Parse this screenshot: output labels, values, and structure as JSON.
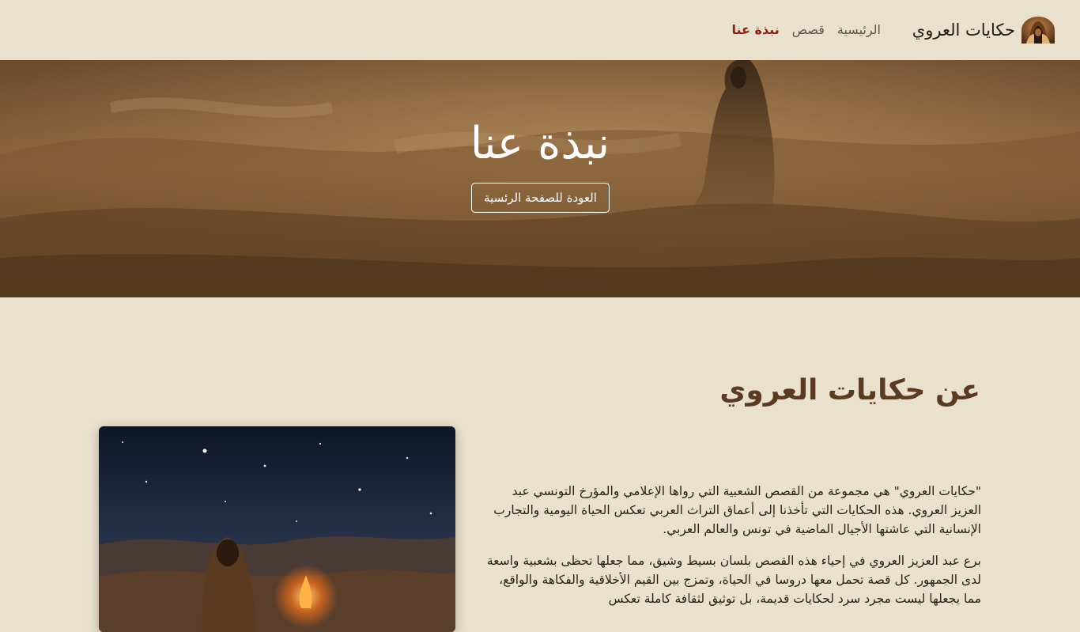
{
  "navbar": {
    "brand_name": "حكايات العروي",
    "links": [
      {
        "label": "الرئيسية"
      },
      {
        "label": "قصص"
      },
      {
        "label": "نبذة عنا"
      }
    ]
  },
  "hero": {
    "title": "نبذة عنا",
    "button_label": "العودة للصفحة الرئسية"
  },
  "about": {
    "title": "عن حكايات العروي",
    "paragraphs": [
      "\"حكايات العروي\" هي مجموعة من القصص الشعبية التي رواها الإعلامي والمؤرخ التونسي عبد العزيز العروي. هذه الحكايات التي تأخذنا إلى أعماق التراث العربي تعكس الحياة اليومية والتجارب الإنسانية التي عاشتها الأجيال الماضية في تونس والعالم العربي.",
      "برع عبد العزيز العروي في إحياء هذه القصص بلسان بسيط وشيق، مما جعلها تحظى بشعبية واسعة لدى الجمهور. كل قصة تحمل معها دروسا في الحياة، وتمزج بين القيم الأخلاقية والفكاهة والواقع، مما يجعلها ليست مجرد سرد لحكايات قديمة، بل توثيق لثقافة كاملة تعكس"
    ]
  },
  "colors": {
    "background": "#e9e0cd",
    "active_link": "#8a1f12",
    "heading": "#5a3b22"
  }
}
